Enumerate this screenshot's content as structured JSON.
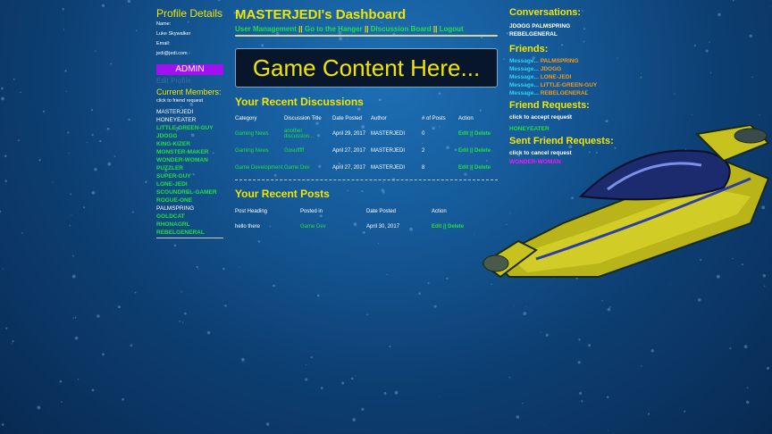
{
  "left": {
    "profile_title": "Profile Details",
    "name_label": "Name:",
    "name_value": "Luke Skywalker",
    "email_label": "Email:",
    "email_value": "jedi@jedi.com",
    "admin_label": "ADMIN",
    "edit_profile": "Edit Profile",
    "members_title": "Current Members:",
    "members_hint": "click to friend request",
    "members": [
      {
        "name": "MASTERJEDI"
      },
      {
        "name": "HONEYEATER"
      },
      {
        "name": "LITTLE-GREEN-GUY"
      },
      {
        "name": "JDOGG"
      },
      {
        "name": "KING-KIZER"
      },
      {
        "name": "MONSTER-MAKER"
      },
      {
        "name": "WONDER-WOMAN"
      },
      {
        "name": "PUZZLER"
      },
      {
        "name": "SUPER-GUY"
      },
      {
        "name": "LONE-JEDI"
      },
      {
        "name": "SCOUNDREL-GAMER"
      },
      {
        "name": "ROGUE-ONE"
      },
      {
        "name": "PALMSPRING"
      },
      {
        "name": "GOLDCAT"
      },
      {
        "name": "RHONAGRL"
      },
      {
        "name": "REBELGENERAL"
      }
    ]
  },
  "center": {
    "title": "MASTERJEDI's Dashboard",
    "nav": [
      "User Management",
      "Go to the Hanger",
      "Discussion Board",
      "Logout"
    ],
    "nav_sep": " || ",
    "game_text": "Game Content Here...",
    "discussions_title": "Your Recent Discussions",
    "discussion_headers": [
      "Category",
      "Discussion Title",
      "Date Posted",
      "Author",
      "# of Posts",
      "Action"
    ],
    "discussions": [
      {
        "category": "Gaming News",
        "title": "another discussion...",
        "date": "April 29, 2017",
        "author": "MASTERJEDI",
        "posts": "0"
      },
      {
        "category": "Gaming News",
        "title": "Gosufffff",
        "date": "April 27, 2017",
        "author": "MASTERJEDI",
        "posts": "2"
      },
      {
        "category": "Game Development",
        "title": "Game Dev",
        "date": "April 27, 2017",
        "author": "MASTERJEDI",
        "posts": "8"
      }
    ],
    "posts_title": "Your Recent Posts",
    "post_headers": [
      "Post Heading",
      "Posted in",
      "Date Posted",
      "Action"
    ],
    "posts": [
      {
        "heading": "hello there",
        "posted_in": "Game Dev",
        "date": "April 30, 2017"
      }
    ],
    "edit_label": "Edit",
    "delete_label": "Delete",
    "action_sep": " || "
  },
  "right": {
    "conv_title": "Conversations:",
    "conversations": [
      "JDOGG PALMSPRING",
      "REBELGENERAL"
    ],
    "friends_title": "Friends:",
    "message_label": "Message...",
    "friends": [
      "PALMSPRING",
      "JDOGG",
      "LONE-JEDI",
      "LITTLE-GREEN-GUY",
      "REBELGENERAL"
    ],
    "requests_title": "Friend Requests:",
    "requests_hint": "click to accept request",
    "requests": [
      "HONEYEATER"
    ],
    "sent_title": "Sent Friend Requests:",
    "sent_hint": "click to cancel request",
    "sent": [
      "WONDER-WOMAN"
    ]
  },
  "colors": {
    "accent_yellow": "#f2e600",
    "link_green": "#22e040",
    "admin_purple": "#a010f0",
    "message_cyan": "#2ad4f2",
    "friend_orange": "#f29a1a",
    "sent_pink": "#ff10ff"
  },
  "icons": [
    "spaceship-illustration"
  ]
}
